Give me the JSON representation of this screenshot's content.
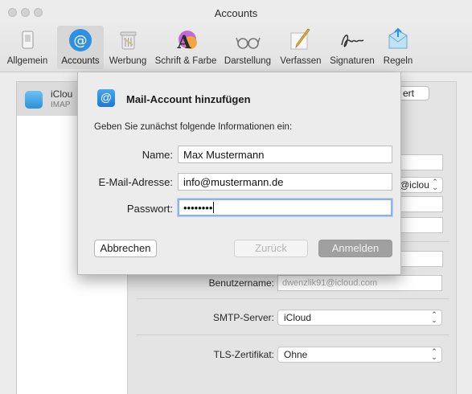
{
  "window": {
    "title": "Accounts"
  },
  "toolbar": {
    "items": [
      {
        "label": "Allgemein"
      },
      {
        "label": "Accounts"
      },
      {
        "label": "Werbung"
      },
      {
        "label": "Schrift & Farbe"
      },
      {
        "label": "Darstellung"
      },
      {
        "label": "Verfassen"
      },
      {
        "label": "Signaturen"
      },
      {
        "label": "Regeln"
      }
    ],
    "active": "Accounts",
    "accent": "#2f8fe0"
  },
  "account_list": {
    "selected": {
      "name": "iClou",
      "type": "IMAP"
    }
  },
  "detail": {
    "partial_button": "ert",
    "partial_select": "@iclou",
    "username_label": "Benutzername:",
    "username_value": "dwenzlik91@icloud.com",
    "smtp_label": "SMTP-Server:",
    "smtp_value": "iCloud",
    "tls_label": "TLS-Zertifikat:",
    "tls_value": "Ohne"
  },
  "dialog": {
    "title": "Mail-Account hinzufügen",
    "subtitle": "Geben Sie zunächst folgende Informationen ein:",
    "fields": {
      "name_label": "Name:",
      "name_value": "Max  Mustermann",
      "email_label": "E-Mail-Adresse:",
      "email_value": "info@mustermann.de",
      "password_label": "Passwort:",
      "password_value": "••••••••"
    },
    "buttons": {
      "cancel": "Abbrechen",
      "back": "Zurück",
      "login": "Anmelden"
    }
  }
}
